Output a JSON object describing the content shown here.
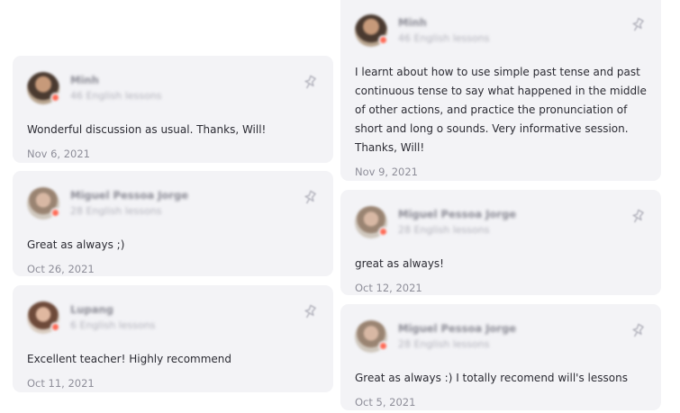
{
  "reviews_left": [
    {
      "name": "Minh",
      "lessons": "46 English lessons",
      "text": "Wonderful discussion as usual. Thanks, Will!",
      "date": "Nov 6, 2021"
    },
    {
      "name": "Miguel Pessoa Jorge",
      "lessons": "28 English lessons",
      "text": "Great as always ;)",
      "date": "Oct 26, 2021"
    },
    {
      "name": "Lupang",
      "lessons": "6 English lessons",
      "text": "Excellent teacher! Highly recommend",
      "date": "Oct 11, 2021"
    }
  ],
  "reviews_right": [
    {
      "name": "Minh",
      "lessons": "46 English lessons",
      "text": "I learnt about how to use simple past tense and past continuous tense to say what happened in the middle of other actions, and practice the pronunciation of short and long o sounds. Very informative session. Thanks, Will!",
      "date": "Nov 9, 2021"
    },
    {
      "name": "Miguel Pessoa Jorge",
      "lessons": "28 English lessons",
      "text": "great as always!",
      "date": "Oct 12, 2021"
    },
    {
      "name": "Miguel Pessoa Jorge",
      "lessons": "28 English lessons",
      "text": "Great as always :) I totally recomend will's lessons",
      "date": "Oct 5, 2021"
    }
  ],
  "icons": {
    "pin": "pin-icon",
    "avatar_badge": "status-dot"
  },
  "colors": {
    "card_bg": "#f3f3f6",
    "badge": "#ff6a55",
    "date": "#8e8e99"
  }
}
